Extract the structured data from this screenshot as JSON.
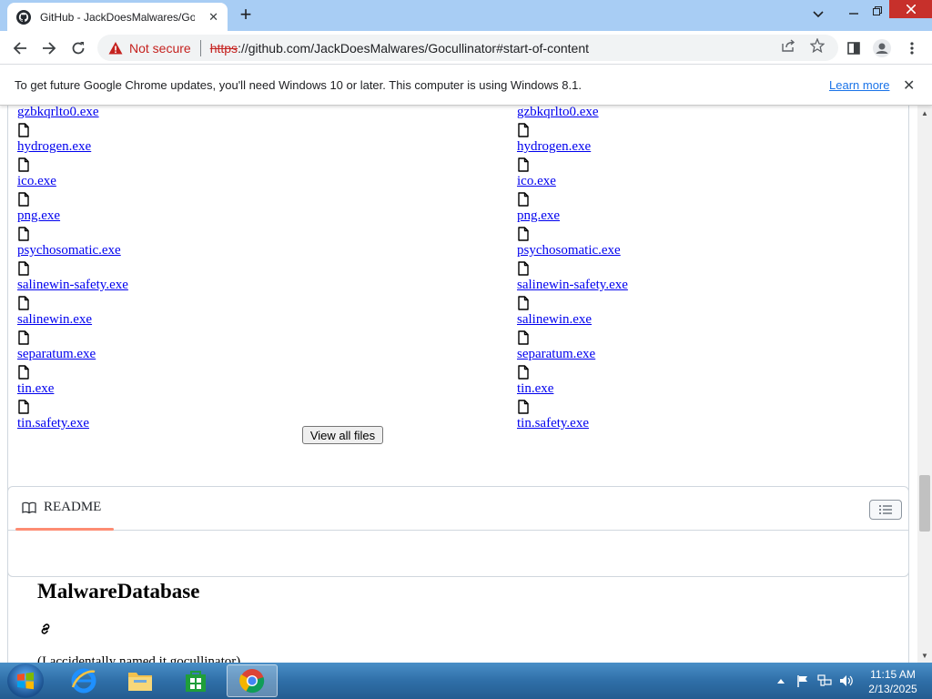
{
  "browser": {
    "tab_title": "GitHub - JackDoesMalwares/Gocullinator",
    "tab_close": "✕",
    "new_tab": "+",
    "not_secure": "Not secure",
    "url_scheme": "https",
    "url_rest": "://github.com/JackDoesMalwares/Gocullinator#start-of-content"
  },
  "infobar": {
    "message": "To get future Google Chrome updates, you'll need Windows 10 or later. This computer is using Windows 8.1.",
    "learn_more": "Learn more",
    "close": "✕"
  },
  "files": {
    "names": [
      "gzbkqrlto0.exe",
      "hydrogen.exe",
      "ico.exe",
      "png.exe",
      "psychosomatic.exe",
      "salinewin-safety.exe",
      "salinewin.exe",
      "separatum.exe",
      "tin.exe",
      "tin.safety.exe"
    ],
    "view_all": "View all files"
  },
  "readme": {
    "tab_label": "README",
    "title": "MalwareDatabase",
    "text": "(I accidentally named it gocullinator)"
  },
  "taskbar": {
    "time": "11:15 AM",
    "date": "2/13/2025"
  }
}
